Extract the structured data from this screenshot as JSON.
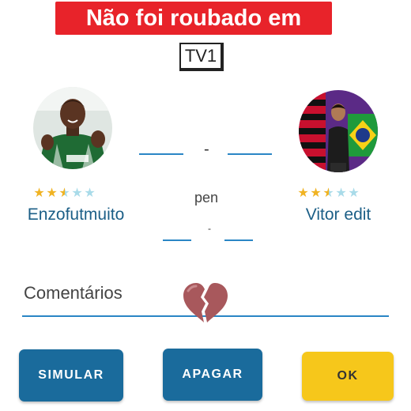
{
  "overlay": {
    "title": "Não foi roubado em"
  },
  "channel": {
    "label": "TV1"
  },
  "players": {
    "left": {
      "name": "Enzofutmuito",
      "rating": 2.5,
      "max_rating": 5
    },
    "right": {
      "name": "Vitor edit",
      "rating": 2.5,
      "max_rating": 5
    }
  },
  "score": {
    "separator": "-"
  },
  "penalties": {
    "label": "pen",
    "separator": "-"
  },
  "comments": {
    "label": "Comentários",
    "emoji": "broken-heart-icon"
  },
  "buttons": {
    "simulate": "SIMULAR",
    "clear": "APAGAR",
    "ok": "OK"
  },
  "colors": {
    "primary": "#1a6b9c",
    "accent": "#f6c71b",
    "underline": "#2a86c5",
    "banner": "#e8232a",
    "star": "#f0b323",
    "star_empty": "#a9dbe9"
  }
}
